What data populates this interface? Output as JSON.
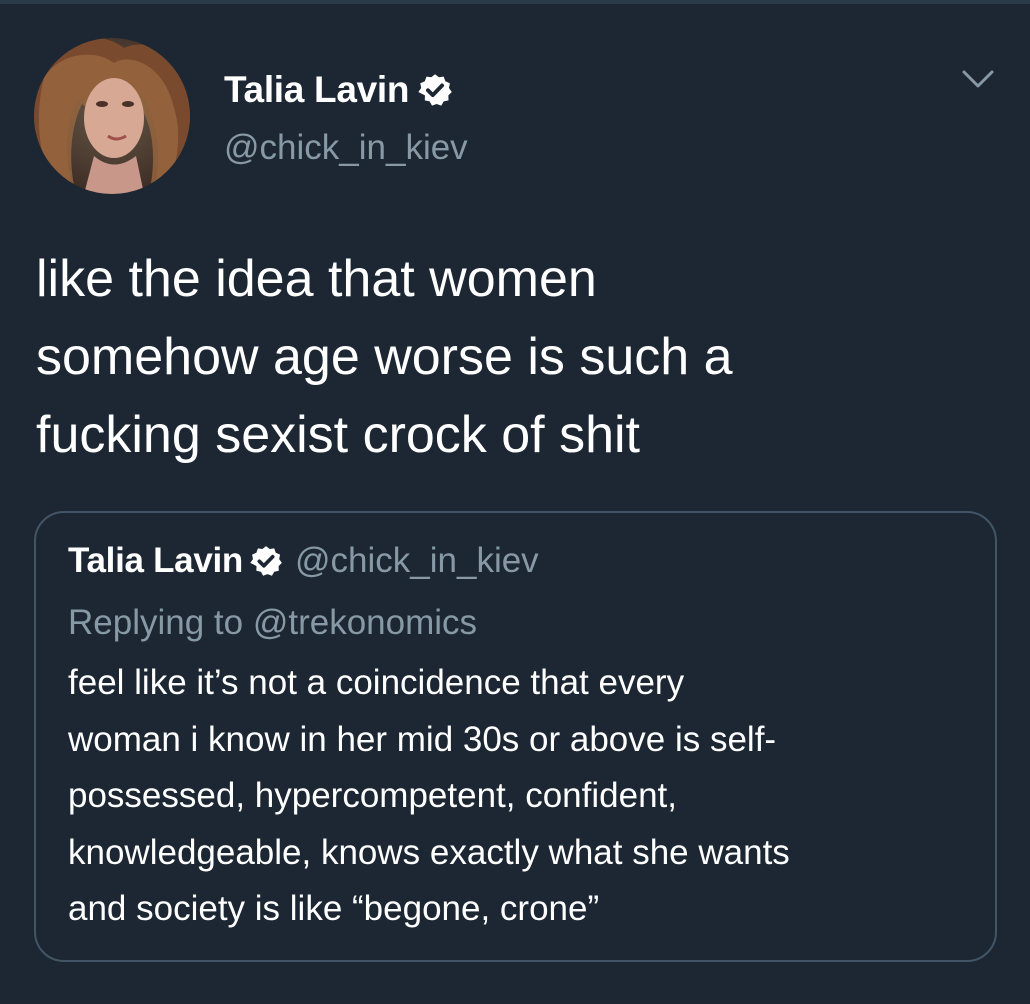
{
  "colors": {
    "background": "#1c2733",
    "text": "#ffffff",
    "secondary_text": "#8899a6",
    "quote_border": "#425566",
    "verified_badge": "#ffffff"
  },
  "tweet": {
    "author": {
      "display_name": "Talia Lavin",
      "handle": "@chick_in_kiev",
      "verified": true,
      "avatar_icon": "profile-photo"
    },
    "menu_icon": "chevron-down-icon",
    "text": "like the idea that women\nsomehow age worse is such a\nfucking sexist crock of shit"
  },
  "quoted_tweet": {
    "author": {
      "display_name": "Talia Lavin",
      "handle": "@chick_in_kiev",
      "verified": true
    },
    "replying_to": "Replying to @trekonomics",
    "text": "feel like it’s not a coincidence that every\nwoman i know in her mid 30s or above is self-\npossessed, hypercompetent, confident,\nknowledgeable, knows exactly what she wants\nand society is like “begone, crone”"
  }
}
